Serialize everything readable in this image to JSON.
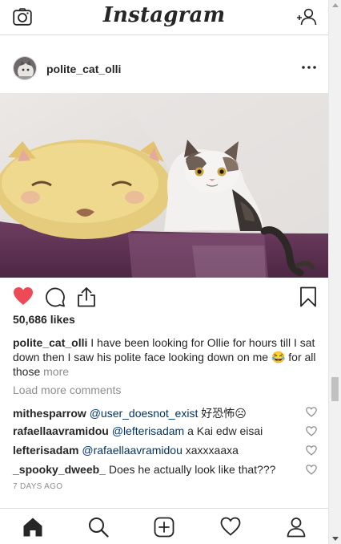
{
  "app": {
    "logo": "Instagram"
  },
  "topbar": {
    "camera_icon": "camera-icon",
    "add_user_icon": "add-user-icon"
  },
  "post": {
    "username": "polite_cat_olli",
    "likes": "50,686 likes",
    "caption_user": "polite_cat_olli",
    "caption_text": " I have been looking for Ollie for hours till I sat down then I saw his polite face looking down on me 😂 for all those ",
    "caption_more": "more",
    "load_more": "Load more comments",
    "timestamp": "7 DAYS AGO",
    "like_color": "#ed4956",
    "comments": [
      {
        "user": "mithesparrow",
        "mention": "@user_doesnot_exist",
        "text": " 好恐怖☹"
      },
      {
        "user": "rafaellaavramidou",
        "mention": "@lefterisadam",
        "text": " a Kai edw eisai"
      },
      {
        "user": "lefterisadam",
        "mention": "@rafaellaavramidou",
        "text": " xaxxxaaxa"
      },
      {
        "user": "_spooky_dweeb_",
        "mention": "",
        "text": " Does he actually look like that???"
      }
    ]
  },
  "nav": [
    "home-icon",
    "search-icon",
    "new-post-icon",
    "activity-heart-icon",
    "profile-icon"
  ]
}
